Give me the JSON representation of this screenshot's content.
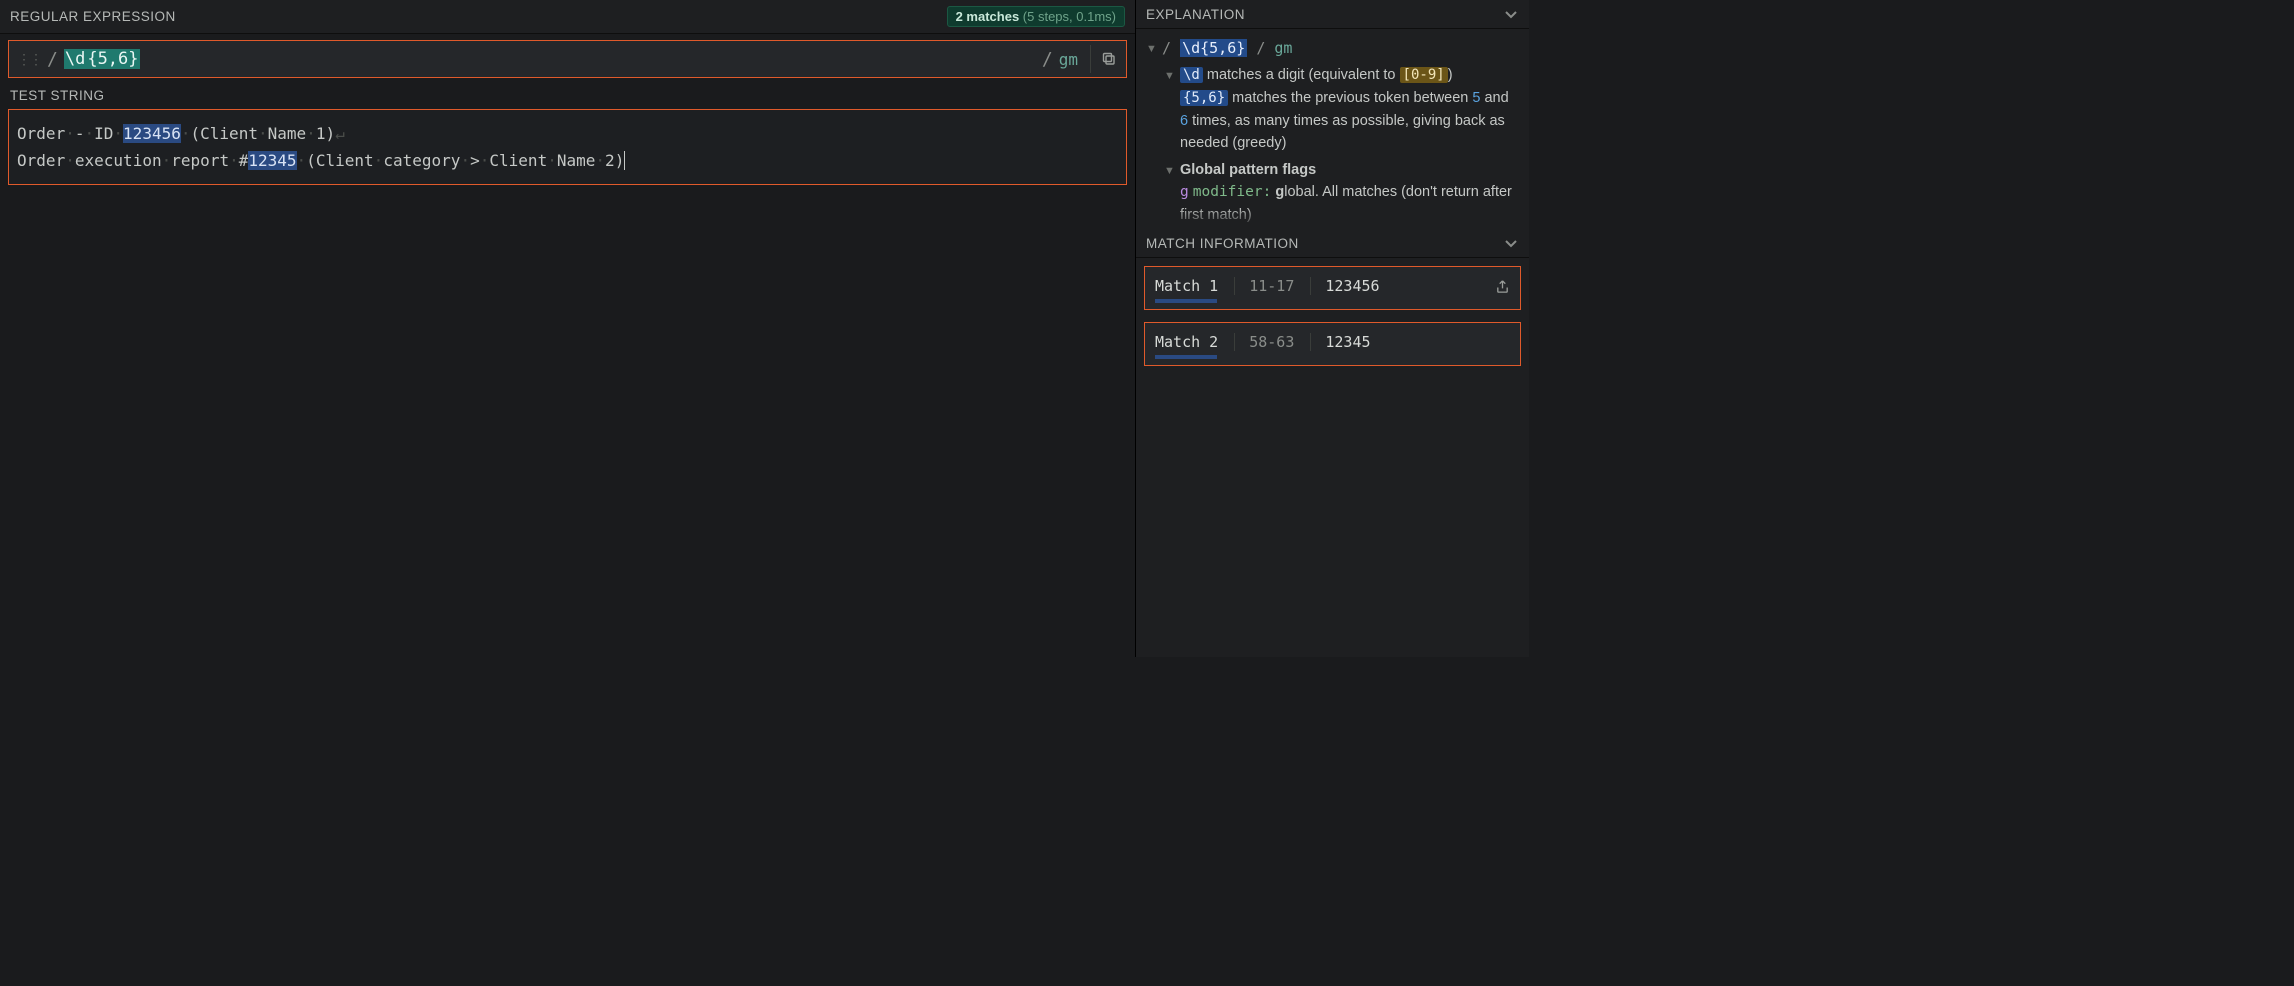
{
  "header": {
    "regex_section_title": "REGULAR EXPRESSION",
    "match_count_bold": "2 matches",
    "match_count_detail": "(5 steps, 0.1ms)"
  },
  "regex": {
    "open_delim": "/",
    "pattern_escape": "\\d",
    "pattern_quant": "{5,6}",
    "close_delim": "/",
    "flags": "gm"
  },
  "test": {
    "section_title": "TEST STRING",
    "line1_pre": "Order - ID ",
    "line1_match": "123456",
    "line1_post": " (Client Name 1)",
    "line2_pre": "Order execution report #",
    "line2_match": "12345",
    "line2_post": " (Client category > Client Name 2)"
  },
  "explanation": {
    "section_title": "EXPLANATION",
    "hdr_open": "/",
    "hdr_pattern": "\\d{5,6}",
    "hdr_close": "/",
    "hdr_flags": "gm",
    "d_token": "\\d",
    "d_text_a": " matches a digit (equivalent to ",
    "d_range": "[0-9]",
    "d_text_b": ")",
    "q_token": "{5,6}",
    "q_text_a": " matches the previous token between ",
    "q_num1": "5",
    "q_text_b": " and ",
    "q_num2": "6",
    "q_text_c": " times, as many times as possible, giving back as needed (greedy)",
    "flags_header": "Global pattern flags",
    "g_flag": "g",
    "g_mod": "modifier:",
    "g_text_a": " ",
    "g_bold": "g",
    "g_text_b": "lobal. All matches (don't return after first match)"
  },
  "match_info": {
    "section_title": "MATCH INFORMATION",
    "matches": [
      {
        "label": "Match 1",
        "range": "11-17",
        "value": "123456"
      },
      {
        "label": "Match 2",
        "range": "58-63",
        "value": "12345"
      }
    ]
  }
}
